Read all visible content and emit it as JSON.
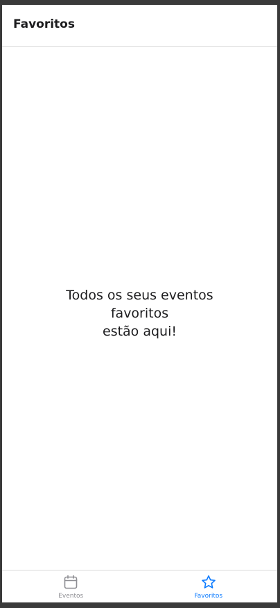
{
  "header": {
    "title": "Favoritos"
  },
  "empty_state": {
    "line1": "Todos os seus eventos",
    "line2": "favoritos",
    "line3": "estão aqui!"
  },
  "tabbar": {
    "tabs": [
      {
        "label": "Eventos",
        "icon": "calendar-icon",
        "active": false
      },
      {
        "label": "Favoritos",
        "icon": "star-icon",
        "active": true
      }
    ]
  },
  "colors": {
    "active_tint": "#0a7aff",
    "inactive_tint": "#8e8e93"
  }
}
